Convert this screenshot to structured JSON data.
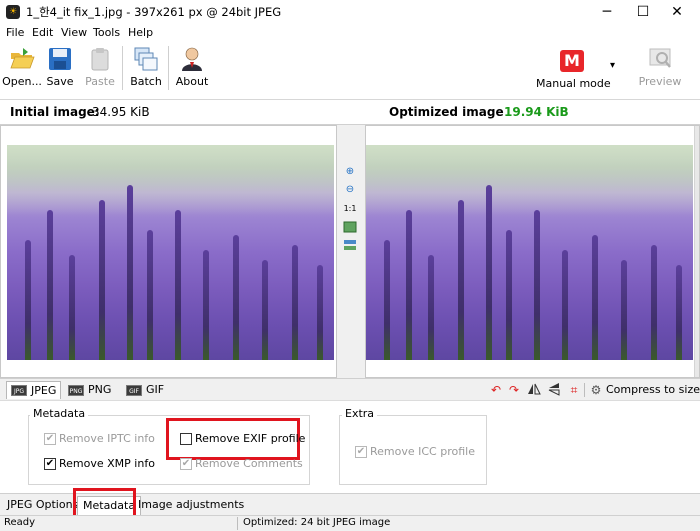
{
  "window": {
    "title": "1_한4_it fix_1.jpg - 397x261 px @ 24bit JPEG",
    "app_icon_text": "☀",
    "minimize": "─",
    "maximize": "☐",
    "close": "✕"
  },
  "menu": {
    "items": [
      "File",
      "Edit",
      "View",
      "Tools",
      "Help"
    ]
  },
  "toolbar": {
    "open": "Open...",
    "save": "Save",
    "paste": "Paste",
    "batch": "Batch",
    "about": "About",
    "mode_letter": "M",
    "mode": "Manual mode",
    "mode_arrow": "▾",
    "preview": "Preview"
  },
  "images": {
    "initial_label": "Initial image:",
    "initial_size": "34.95 KiB",
    "optimized_label": "Optimized image",
    "optimized_size": "19.94 KiB",
    "zoom_one": "1:1"
  },
  "format_tabs": {
    "jpeg": "JPEG",
    "png": "PNG",
    "gif": "GIF",
    "jpeg_icon": "JPG",
    "png_icon": "PNG",
    "gif_icon": "GIF",
    "compress": "Compress to size"
  },
  "options": {
    "metadata_group": "Metadata",
    "remove_iptc": "Remove IPTC info",
    "remove_xmp": "Remove XMP info",
    "remove_exif": "Remove EXIF profile",
    "remove_comments": "Remove Comments",
    "extra_group": "Extra",
    "remove_icc": "Remove ICC profile",
    "check_mark": "✔"
  },
  "bottom_tabs": {
    "jpeg_options": "JPEG Options",
    "metadata": "Metadata",
    "image_adjustments": "Image adjustments"
  },
  "status": {
    "left": "Ready",
    "center": "Optimized: 24 bit JPEG image"
  },
  "colors": {
    "optimized_size": "#1a9a1a",
    "highlight": "#e0141e",
    "mode_red": "#e8262a"
  }
}
